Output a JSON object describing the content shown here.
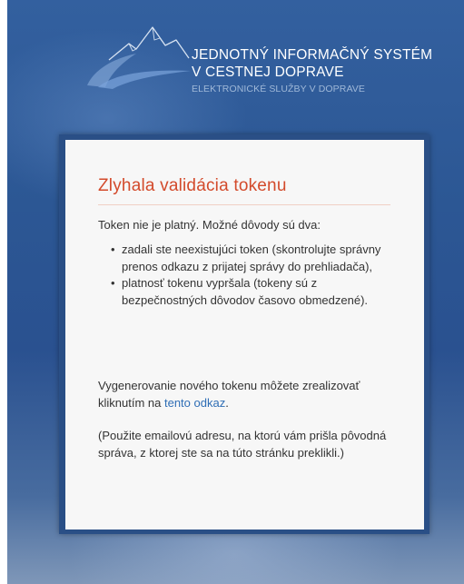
{
  "header": {
    "logo_line1": "JEDNOTNÝ INFORMAČNÝ SYSTÉM",
    "logo_line2": "V CESTNEJ DOPRAVE",
    "logo_line3": "ELEKTRONICKÉ SLUŽBY V DOPRAVE"
  },
  "error_panel": {
    "title": "Zlyhala validácia tokenu",
    "intro": "Token nie je platný. Možné dôvody sú dva:",
    "reasons": [
      "zadali ste neexistujúci token (skontrolujte správny prenos odkazu z prijatej správy do prehliadača),",
      "platnosť tokenu vypršala (tokeny sú z bezpečnostných dôvodov časovo obmedzené)."
    ],
    "regen_text": "Vygenerovanie nového tokenu môžete zrealizovať kliknutím na ",
    "regen_link": "tento odkaz",
    "regen_end": ".",
    "note": "(Použite emailovú adresu, na ktorú vám prišla pôvodná správa, z ktorej ste sa na túto stránku preklikli.)"
  },
  "colors": {
    "title_red": "#d34a2b",
    "link_blue": "#2f6eb5",
    "background_blue": "#2c5794"
  }
}
